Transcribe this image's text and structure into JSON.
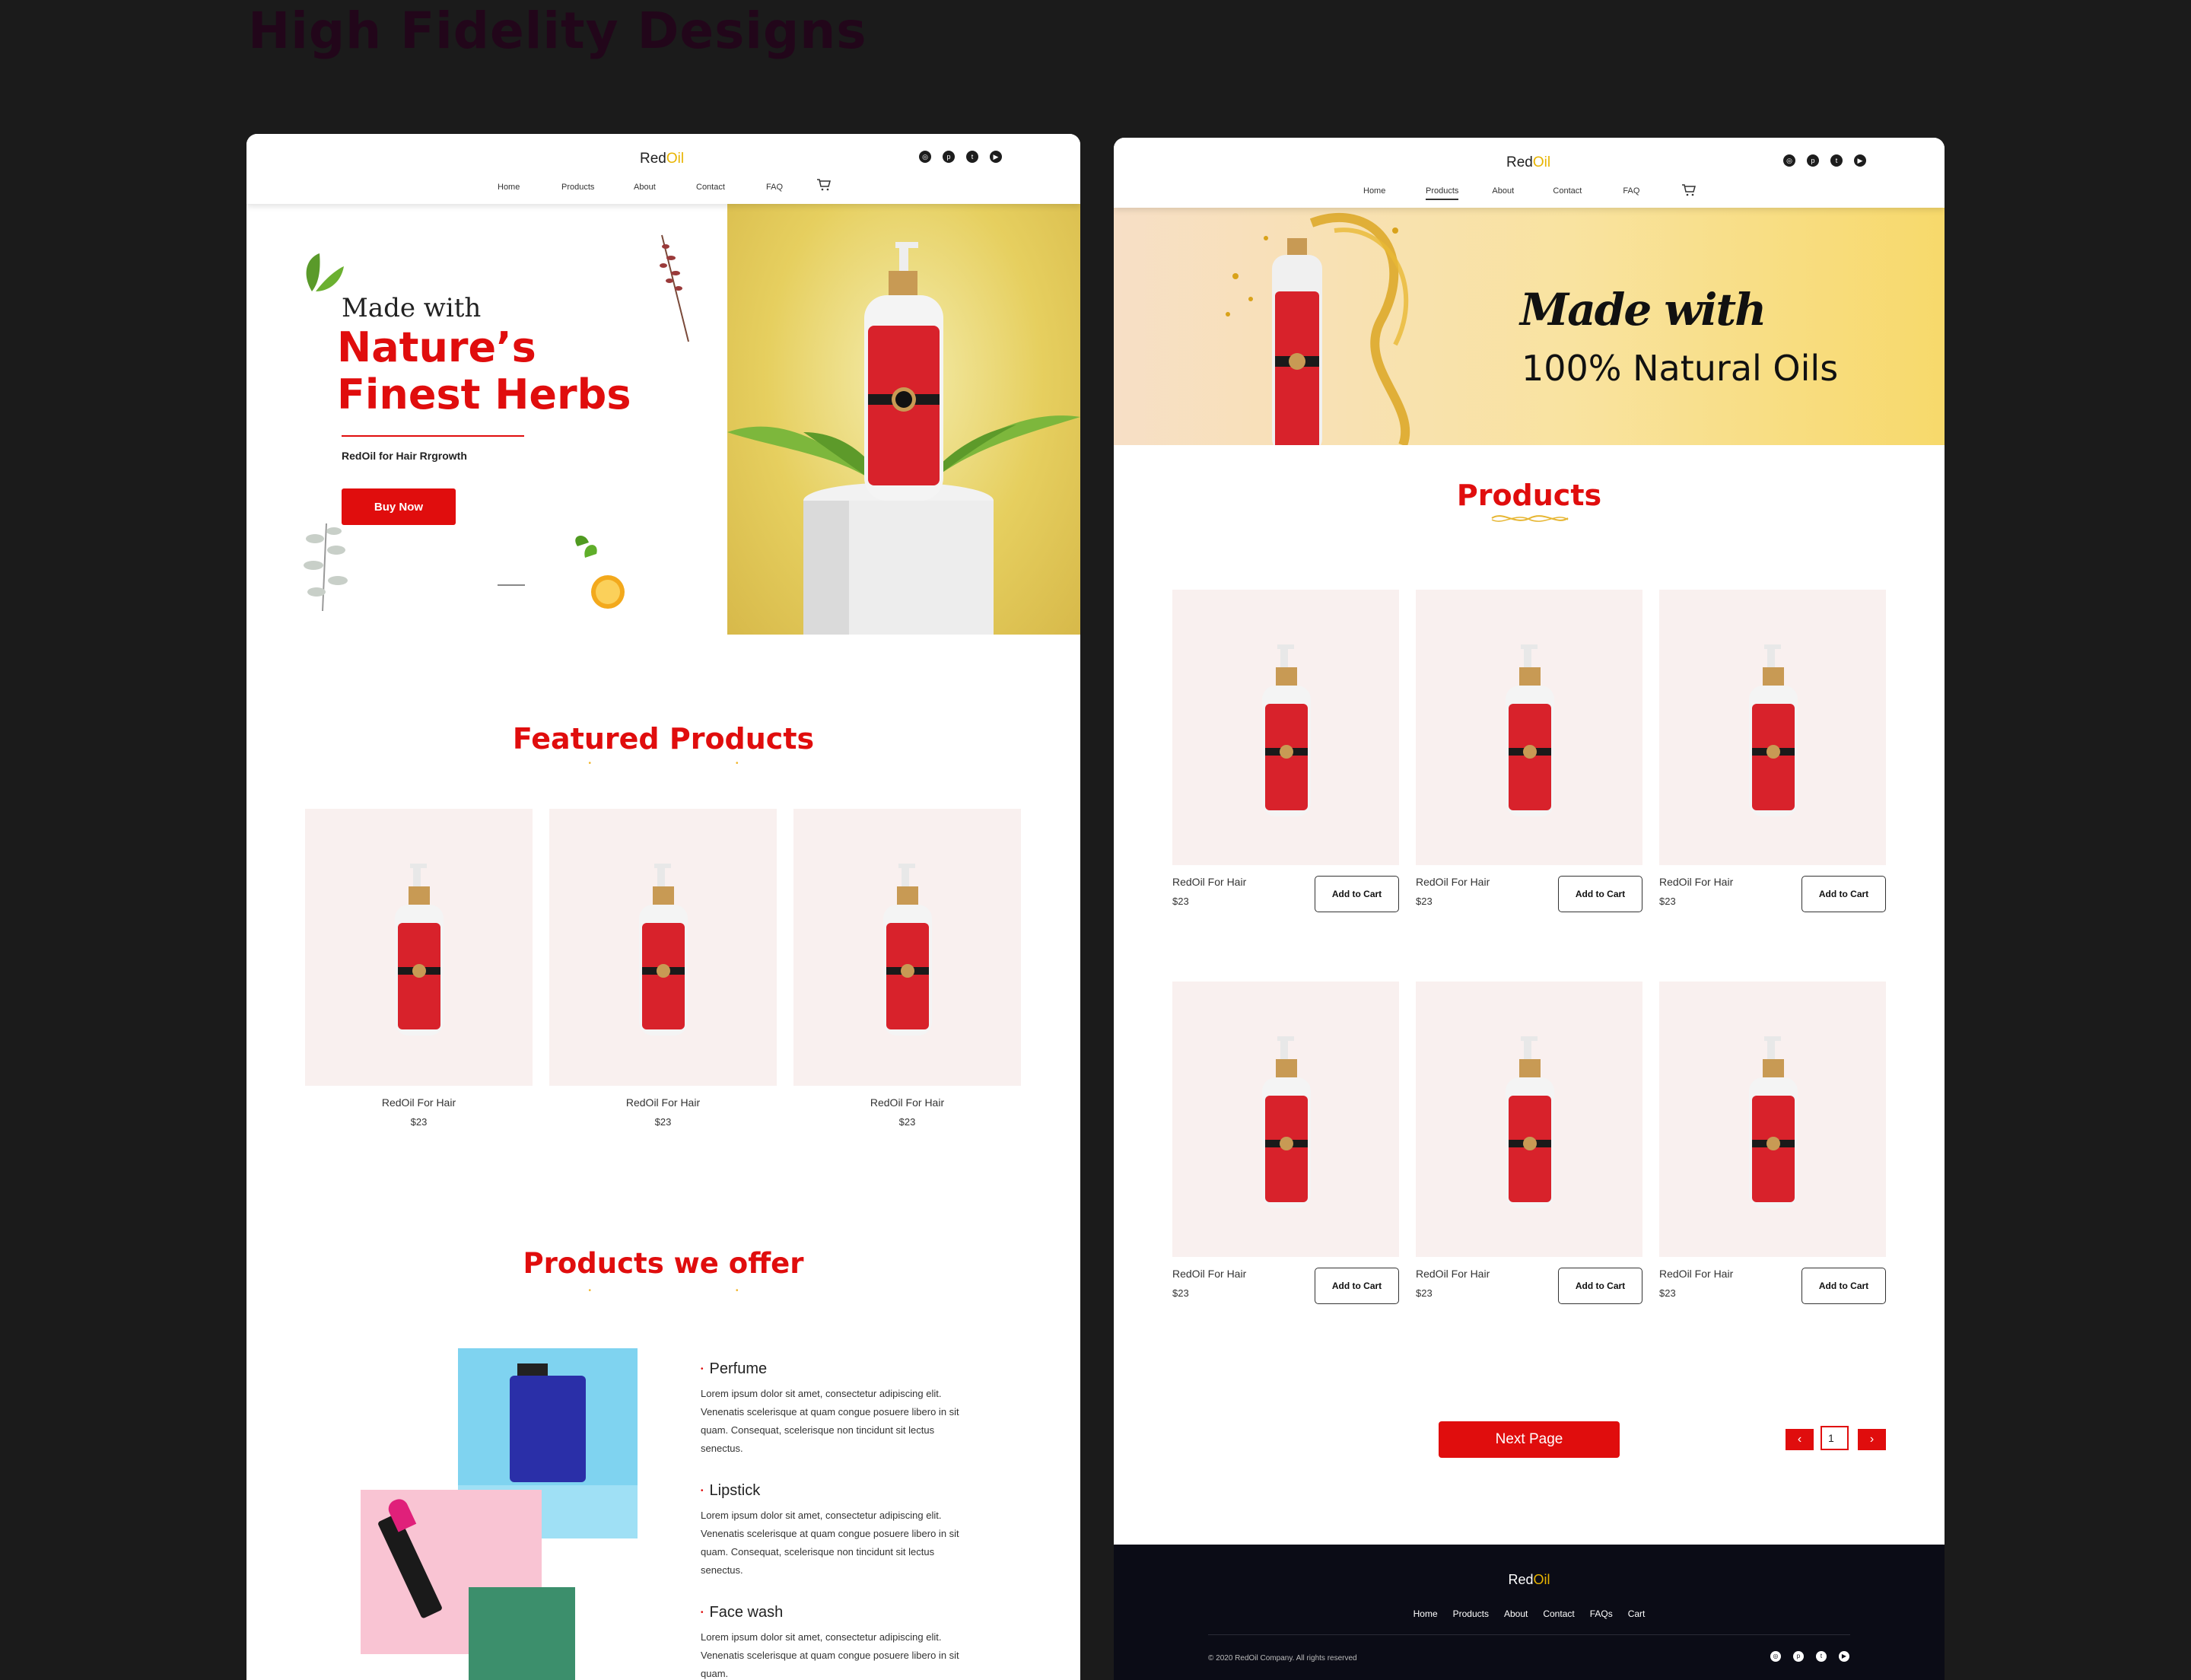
{
  "heading": "High Fidelity Designs",
  "brand": {
    "name_part1": "Red",
    "name_part2": "Oil",
    "accent": "#e00d0d",
    "gold": "#e8b400"
  },
  "nav": [
    "Home",
    "Products",
    "About",
    "Contact",
    "FAQ"
  ],
  "social_icons": [
    "instagram-icon",
    "pinterest-icon",
    "twitter-icon",
    "youtube-icon"
  ],
  "home": {
    "hero": {
      "made_with": "Made with",
      "headline": "Nature’s Finest Herbs",
      "subtitle": "RedOil for Hair Rrgrowth",
      "cta": "Buy Now"
    },
    "featured_title": "Featured Products",
    "featured": [
      {
        "name": "RedOil For Hair",
        "price": "$23"
      },
      {
        "name": "RedOil For Hair",
        "price": "$23"
      },
      {
        "name": "RedOil For Hair",
        "price": "$23"
      }
    ],
    "offer_title": "Products we offer",
    "offer": [
      {
        "title": "Perfume",
        "desc": "Lorem ipsum dolor sit amet, consectetur adipiscing elit. Venenatis scelerisque at quam congue posuere libero in sit quam. Consequat, scelerisque non tincidunt sit lectus senectus."
      },
      {
        "title": "Lipstick",
        "desc": "Lorem ipsum dolor sit amet, consectetur adipiscing elit. Venenatis scelerisque at quam congue posuere libero in sit quam. Consequat, scelerisque non tincidunt sit lectus senectus."
      },
      {
        "title": "Face wash",
        "desc": "Lorem ipsum dolor sit amet, consectetur adipiscing elit. Venenatis scelerisque at quam congue posuere libero in sit quam."
      }
    ]
  },
  "products_page": {
    "active_nav": "Products",
    "hero": {
      "made_with": "Made with",
      "tagline": "100% Natural Oils"
    },
    "title": "Products",
    "products": [
      {
        "name": "RedOil For Hair",
        "price": "$23",
        "button": "Add to Cart"
      },
      {
        "name": "RedOil For Hair",
        "price": "$23",
        "button": "Add to Cart"
      },
      {
        "name": "RedOil For Hair",
        "price": "$23",
        "button": "Add to Cart"
      },
      {
        "name": "RedOil For Hair",
        "price": "$23",
        "button": "Add to Cart"
      },
      {
        "name": "RedOil For Hair",
        "price": "$23",
        "button": "Add to Cart"
      },
      {
        "name": "RedOil For Hair",
        "price": "$23",
        "button": "Add to Cart"
      }
    ],
    "next_page": "Next Page",
    "page_number": "1",
    "footer": {
      "nav": [
        "Home",
        "Products",
        "About",
        "Contact",
        "FAQs",
        "Cart"
      ],
      "copyright": "© 2020 RedOil Company. All rights reserved"
    }
  }
}
